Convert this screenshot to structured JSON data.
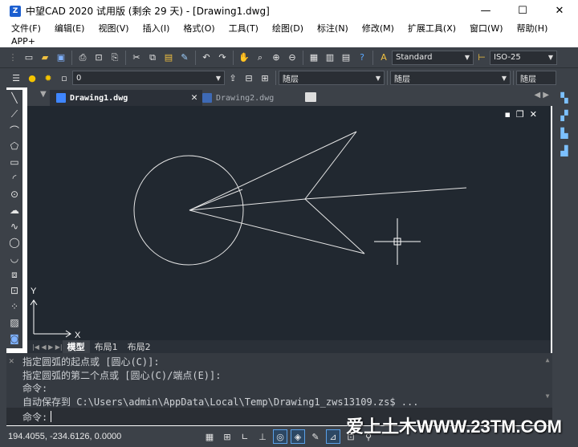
{
  "window": {
    "title": "中望CAD 2020 试用版 (剩余 29 天) - [Drawing1.dwg]",
    "logo_text": "Z",
    "min_glyph": "—",
    "max_glyph": "☐",
    "close_glyph": "✕"
  },
  "menu": {
    "row1": [
      "文件(F)",
      "编辑(E)",
      "视图(V)",
      "插入(I)",
      "格式(O)",
      "工具(T)",
      "绘图(D)",
      "标注(N)",
      "修改(M)",
      "扩展工具(X)",
      "窗口(W)",
      "帮助(H)"
    ],
    "row2": [
      "APP+"
    ]
  },
  "toolbar1": {
    "text_style": "Standard",
    "dim_style": "ISO-25"
  },
  "toolbar2": {
    "layer": "0",
    "color": "随层",
    "linetype": "随层",
    "lineweight": "随层"
  },
  "tabs": {
    "active": "Drawing1.dwg",
    "inactive": "Drawing2.dwg",
    "close_glyph": "✕",
    "nav": "◀ ▶"
  },
  "canvas": {
    "controls": "▪❐✕",
    "ucs_x": "X",
    "ucs_y": "Y"
  },
  "layout_tabs": {
    "nav": "|◀ ◀ ▶ ▶|",
    "model": "模型",
    "layout1": "布局1",
    "layout2": "布局2"
  },
  "command_history": [
    "指定圆弧的起点或 [圆心(C)]:",
    "指定圆弧的第二个点或 [圆心(C)/端点(E)]:",
    "命令:",
    "自动保存到 C:\\Users\\admin\\AppData\\Local\\Temp\\Drawing1_zws13109.zs$ ..."
  ],
  "command": {
    "prompt": "命令:",
    "value": "",
    "close_glyph": "✕",
    "scroll_up": "▲",
    "scroll_down": "▼"
  },
  "status": {
    "coords": "194.4055, -234.6126, 0.0000"
  },
  "watermark": "爱上土木WWW.23TM.COM",
  "colors": {
    "canvas_bg": "#212830",
    "toolbar_bg": "#3c4148",
    "drawing_line": "#ffffff"
  }
}
